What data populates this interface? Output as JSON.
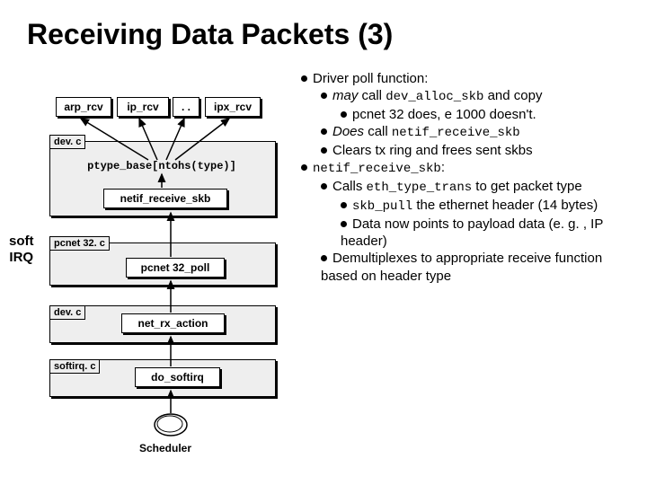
{
  "title": "Receiving Data Packets (3)",
  "side_label_line1": "soft",
  "side_label_line2": "IRQ",
  "diagram": {
    "top_row": {
      "arp": "arp_rcv",
      "ip": "ip_rcv",
      "dots": ". .",
      "ipx": "ipx_rcv"
    },
    "dev_box1_tag": "dev. c",
    "ptype_line": "ptype_base[ntohs(type)]",
    "netif_label": "netif_receive_skb",
    "pcnet_tag": "pcnet 32. c",
    "pcnet_poll": "pcnet 32_poll",
    "dev_box2_tag": "dev. c",
    "netrx": "net_rx_action",
    "softirq_tag": "softirq. c",
    "dosoft": "do_softirq",
    "scheduler": "Scheduler"
  },
  "bullets": {
    "h1": "Driver poll function:",
    "b1a_pre": "may",
    "b1a_mid": " call ",
    "b1a_code": "dev_alloc_skb",
    "b1a_post": " and copy",
    "b1a_sub": "pcnet 32 does, e 1000 doesn't.",
    "b1b_pre": "Does",
    "b1b_mid": " call ",
    "b1b_code": "netif_receive_skb",
    "b1c": "Clears tx ring and frees sent skbs",
    "h2_code": "netif_receive_skb",
    "h2_post": ":",
    "b2a_pre": "Calls ",
    "b2a_code": "eth_type_trans",
    "b2a_post": " to get packet type",
    "b2a_sub1_code": "skb_pull",
    "b2a_sub1_post": " the ethernet header (14 bytes)",
    "b2a_sub2": "Data now points to payload data (e. g. , IP header)",
    "b2b": "Demultiplexes to appropriate receive function based on header type"
  }
}
